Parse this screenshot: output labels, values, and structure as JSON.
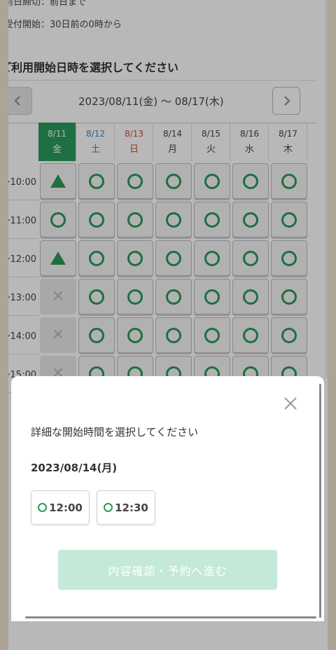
{
  "colors": {
    "accent": "#2a9a5a",
    "saturday": "#3a86c6",
    "sunday": "#d24a3a",
    "proceed_disabled": "#c4e9d8",
    "overlay": "rgba(0,0,0,0.28)",
    "backdrop": "#efe4d2"
  },
  "page": {
    "info_lines": [
      "前日締切：前日まで",
      "受付開始：30日前の0時から"
    ],
    "section_heading": "ご利用開始日時を選択してください",
    "date_range": "2023/08/11(金) 〜 08/17(木)",
    "prev_icon": "chevron-left-icon",
    "next_icon": "chevron-right-icon"
  },
  "calendar": {
    "days": [
      {
        "date": "8/11",
        "weekday": "金",
        "kind": "selected"
      },
      {
        "date": "8/12",
        "weekday": "土",
        "kind": "sat"
      },
      {
        "date": "8/13",
        "weekday": "日",
        "kind": "sun"
      },
      {
        "date": "8/14",
        "weekday": "月",
        "kind": "plain"
      },
      {
        "date": "8/15",
        "weekday": "火",
        "kind": "plain"
      },
      {
        "date": "8/16",
        "weekday": "水",
        "kind": "plain"
      },
      {
        "date": "8/17",
        "weekday": "木",
        "kind": "plain"
      }
    ],
    "rows": [
      {
        "time": "10:00〜",
        "marks": [
          "triangle",
          "circle",
          "circle",
          "circle",
          "circle",
          "circle",
          "circle"
        ]
      },
      {
        "time": "11:00〜",
        "marks": [
          "circle",
          "circle",
          "circle",
          "circle",
          "circle",
          "circle",
          "circle"
        ]
      },
      {
        "time": "12:00〜",
        "marks": [
          "triangle",
          "circle",
          "circle",
          "circle",
          "circle",
          "circle",
          "circle"
        ]
      },
      {
        "time": "13:00〜",
        "marks": [
          "cross",
          "circle",
          "circle",
          "circle",
          "circle",
          "circle",
          "circle"
        ]
      },
      {
        "time": "14:00〜",
        "marks": [
          "cross",
          "circle",
          "circle",
          "circle",
          "circle",
          "circle",
          "circle"
        ]
      },
      {
        "time": "15:00〜",
        "marks": [
          "cross",
          "circle",
          "circle",
          "circle",
          "circle",
          "circle",
          "circle"
        ]
      }
    ],
    "cross_symbol": "✕"
  },
  "sheet": {
    "close_icon": "close-icon",
    "heading": "詳細な開始時間を選択してください",
    "date": "2023/08/14(月)",
    "slots": [
      {
        "time": "12:00",
        "icon": "circle-available-icon"
      },
      {
        "time": "12:30",
        "icon": "circle-available-icon"
      }
    ],
    "proceed_label": "内容確認・予約へ進む"
  }
}
